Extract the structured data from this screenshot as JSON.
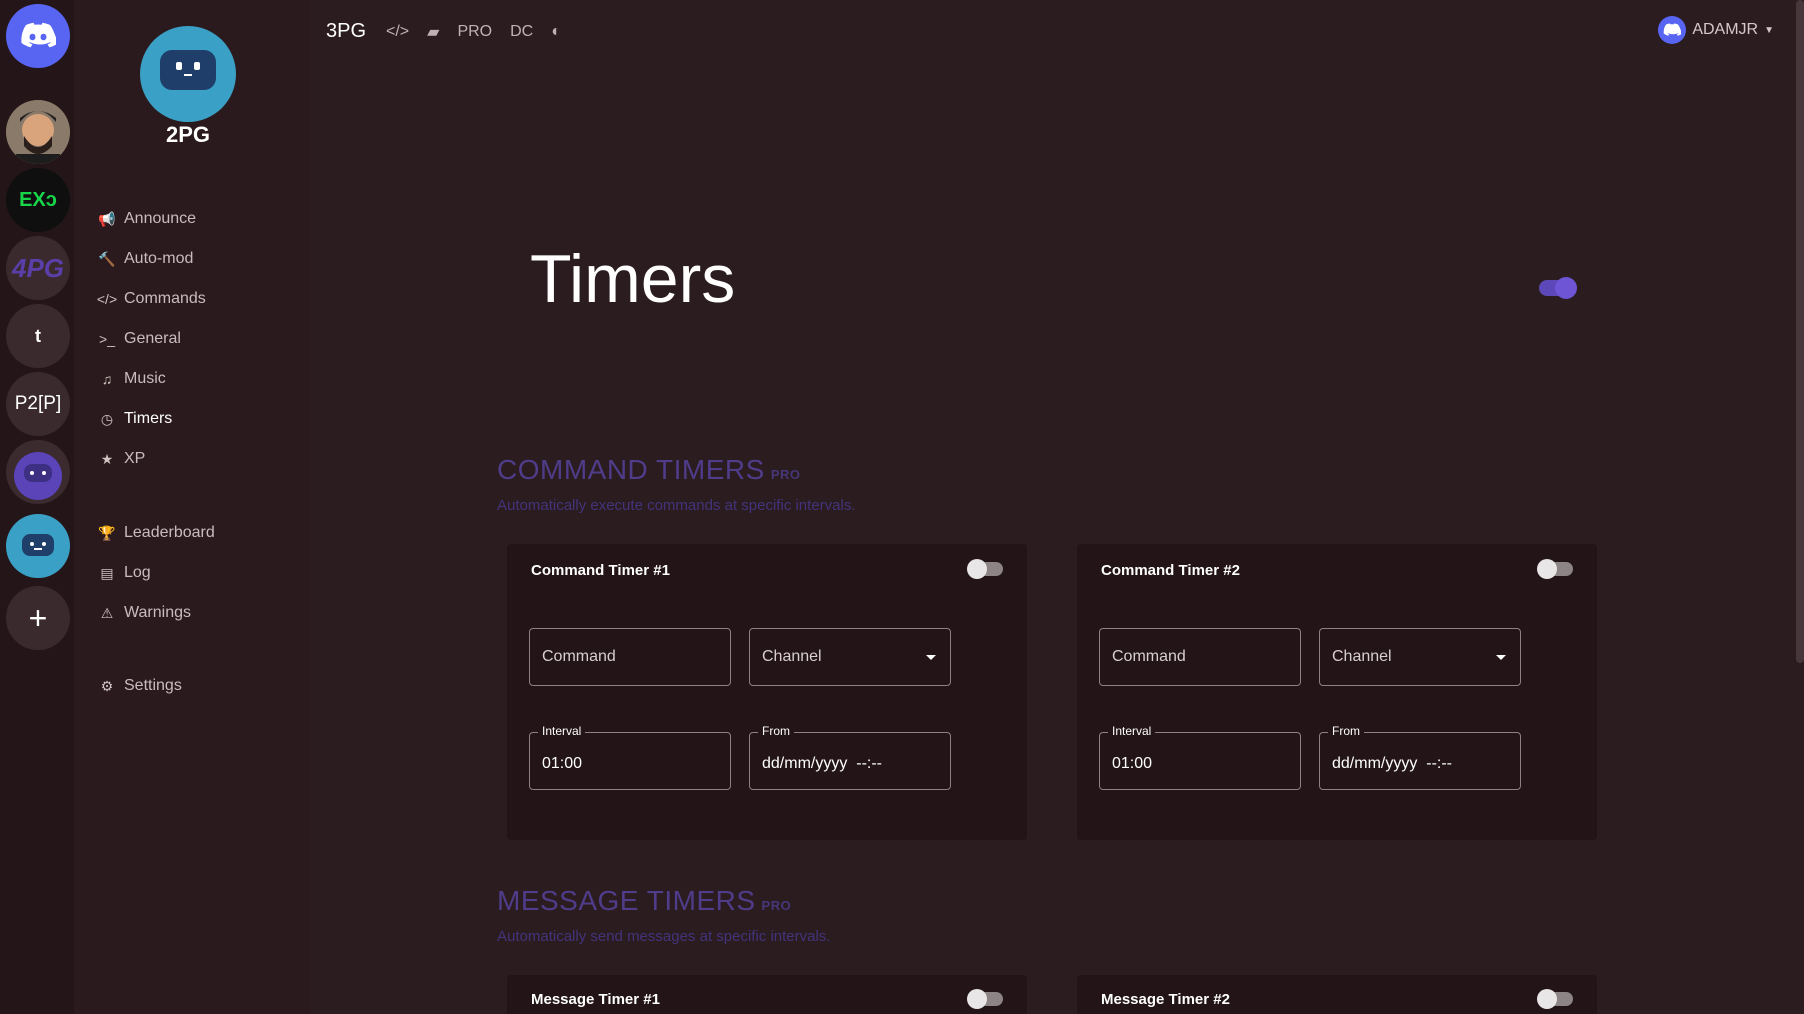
{
  "guilds": [
    {
      "name": "discord-home",
      "text": ""
    },
    {
      "name": "user-avatar-guild",
      "text": ""
    },
    {
      "name": "exo-guild",
      "text": "EXↄ"
    },
    {
      "name": "4pg-guild",
      "text": "4PG"
    },
    {
      "name": "t-guild",
      "text": "t"
    },
    {
      "name": "p2p-guild",
      "text": "P2[P]"
    },
    {
      "name": "robot-guild",
      "text": ""
    },
    {
      "name": "2pg-guild",
      "text": ""
    },
    {
      "name": "add-guild",
      "text": "+"
    }
  ],
  "bot": {
    "name": "2PG"
  },
  "nav": {
    "announce": "Announce",
    "automod": "Auto-mod",
    "commands": "Commands",
    "general": "General",
    "music": "Music",
    "timers": "Timers",
    "xp": "XP",
    "leaderboard": "Leaderboard",
    "log": "Log",
    "warnings": "Warnings",
    "settings": "Settings"
  },
  "topbar": {
    "brand": "3PG",
    "pro": "PRO",
    "dc": "DC",
    "user": "ADAMJR"
  },
  "page": {
    "title": "Timers",
    "enabled": true
  },
  "command_timers": {
    "title": "COMMAND TIMERS",
    "badge": "PRO",
    "desc": "Automatically execute commands at specific intervals.",
    "cards": [
      {
        "title": "Command Timer #1",
        "command_ph": "Command",
        "channel_ph": "Channel",
        "interval_label": "Interval",
        "interval": "01:00",
        "from_label": "From",
        "from": "dd/mm/yyyy  --:--",
        "enabled": false
      },
      {
        "title": "Command Timer #2",
        "command_ph": "Command",
        "channel_ph": "Channel",
        "interval_label": "Interval",
        "interval": "01:00",
        "from_label": "From",
        "from": "dd/mm/yyyy  --:--",
        "enabled": false
      }
    ]
  },
  "message_timers": {
    "title": "MESSAGE TIMERS",
    "badge": "PRO",
    "desc": "Automatically send messages at specific intervals.",
    "cards": [
      {
        "title": "Message Timer #1",
        "enabled": false
      },
      {
        "title": "Message Timer #2",
        "enabled": false
      }
    ]
  },
  "colors": {
    "accent": "#5c48b8",
    "section": "#4f3c8a",
    "background": "#2b1c1f",
    "card": "#221417"
  }
}
